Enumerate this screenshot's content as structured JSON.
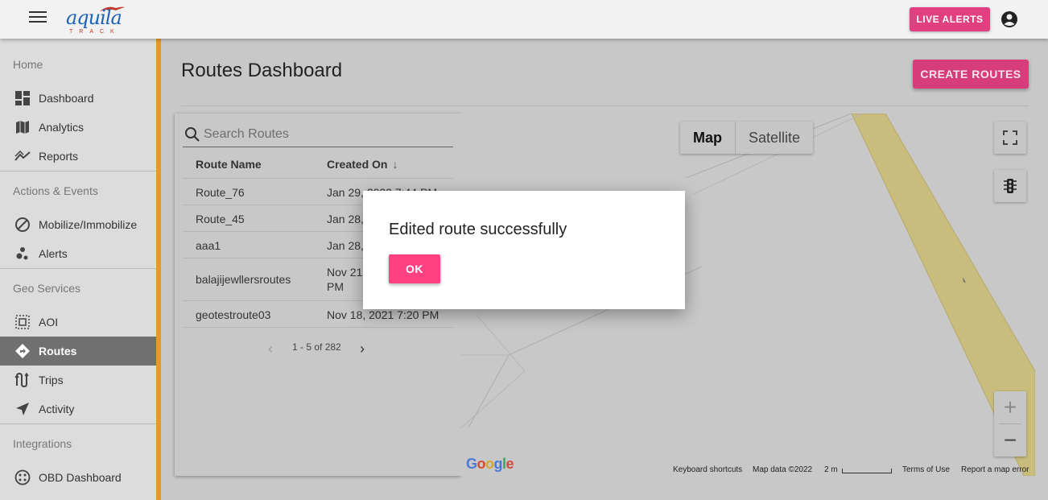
{
  "header": {
    "logo_text": "aquila",
    "logo_sub": "TRACK",
    "live_alerts_label": "LIVE ALERTS"
  },
  "sidebar": {
    "sections": [
      {
        "title": "Home",
        "items": [
          {
            "label": "Dashboard",
            "icon": "dashboard-icon"
          },
          {
            "label": "Analytics",
            "icon": "map-icon"
          },
          {
            "label": "Reports",
            "icon": "trending-icon"
          }
        ]
      },
      {
        "title": "Actions & Events",
        "items": [
          {
            "label": "Mobilize/Immobilize",
            "icon": "block-icon"
          },
          {
            "label": "Alerts",
            "icon": "bubble-chart-icon"
          }
        ]
      },
      {
        "title": "Geo Services",
        "items": [
          {
            "label": "AOI",
            "icon": "select-area-icon"
          },
          {
            "label": "Routes",
            "icon": "directions-icon",
            "active": true
          },
          {
            "label": "Trips",
            "icon": "trips-icon"
          },
          {
            "label": "Activity",
            "icon": "navigation-arrow-icon"
          }
        ]
      },
      {
        "title": "Integrations",
        "items": [
          {
            "label": "OBD Dashboard",
            "icon": "obd-icon"
          }
        ]
      }
    ]
  },
  "main": {
    "page_title": "Routes Dashboard",
    "create_button_label": "CREATE ROUTES"
  },
  "routes_table": {
    "search_placeholder": "Search Routes",
    "columns": [
      "Route Name",
      "Created On"
    ],
    "rows": [
      {
        "name": "Route_76",
        "created": "Jan 29, 2022 7:44 PM"
      },
      {
        "name": "Route_45",
        "created": "Jan 28,"
      },
      {
        "name": "aaa1",
        "created": "Jan 28,"
      },
      {
        "name": "balajijewllersroutes",
        "created": "Nov 21",
        "created_line2": "PM"
      },
      {
        "name": "geotestroute03",
        "created": "Nov 18, 2021 7:20 PM"
      }
    ],
    "pagination": "1 - 5 of 282"
  },
  "map": {
    "map_label": "Map",
    "satellite_label": "Satellite",
    "google_logo": "Google",
    "footer": {
      "shortcuts": "Keyboard shortcuts",
      "map_data": "Map data ©2022",
      "scale": "2 m",
      "terms": "Terms of Use",
      "report": "Report a map error"
    }
  },
  "dialog": {
    "message": "Edited route successfully",
    "ok_label": "OK"
  },
  "colors": {
    "accent_pink": "#ff4081",
    "button_pink": "#d73d7a",
    "active_nav": "#707070",
    "scroll_orange": "#e89a1f"
  }
}
